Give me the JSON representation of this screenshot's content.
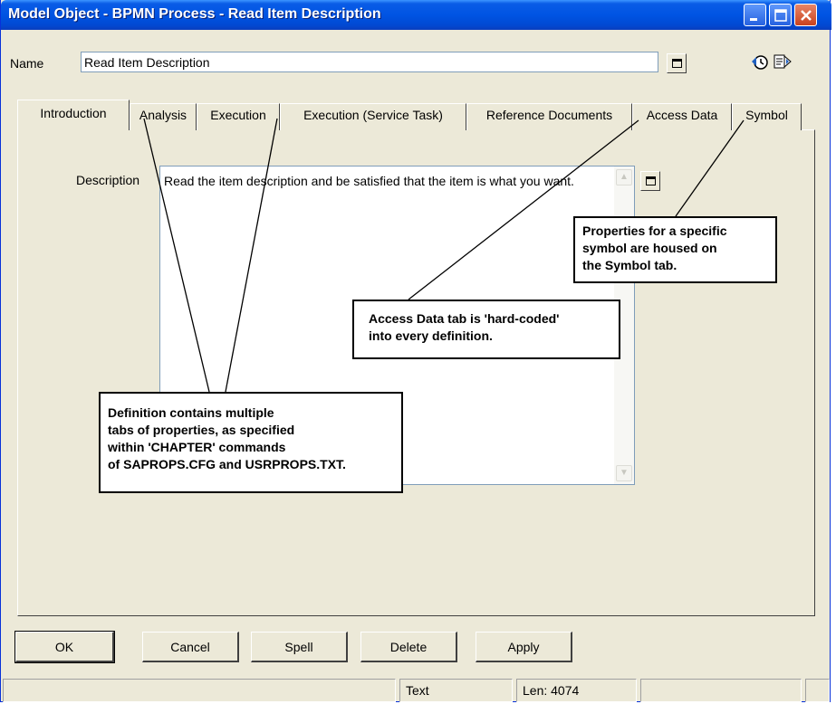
{
  "window": {
    "title": "Model Object - BPMN Process - Read Item Description"
  },
  "name_row": {
    "label": "Name",
    "value": "Read Item Description"
  },
  "tabs": [
    {
      "label": "Introduction",
      "active": true
    },
    {
      "label": "Analysis",
      "active": false
    },
    {
      "label": "Execution",
      "active": false
    },
    {
      "label": "Execution (Service Task)",
      "active": false
    },
    {
      "label": "Reference Documents",
      "active": false
    },
    {
      "label": "Access Data",
      "active": false
    },
    {
      "label": "Symbol",
      "active": false
    }
  ],
  "description": {
    "label": "Description",
    "text": "Read the item description and be satisfied that the item is what you want."
  },
  "callouts": {
    "definition": [
      "Definition contains multiple",
      "tabs of properties, as specified",
      "within 'CHAPTER' commands",
      "of SAPROPS.CFG and USRPROPS.TXT."
    ],
    "access_data": [
      "Access Data tab is 'hard-coded'",
      "into every definition."
    ],
    "symbol": [
      "Properties for a specific",
      "symbol are housed on",
      "the Symbol tab."
    ]
  },
  "buttons": {
    "ok": "OK",
    "cancel": "Cancel",
    "spell": "Spell",
    "delete": "Delete",
    "apply": "Apply"
  },
  "status_bar": {
    "mode": "Text",
    "length": "Len: 4074"
  },
  "icons": {
    "minimize": "minimize-icon",
    "maximize": "maximize-icon",
    "close": "close-icon",
    "expand": "expand-window-icon",
    "history": "history-icon",
    "properties": "properties-icon"
  },
  "colors": {
    "titlebar": "#0054e3",
    "dialog_bg": "#ece9d8",
    "close_button": "#c9421e"
  }
}
